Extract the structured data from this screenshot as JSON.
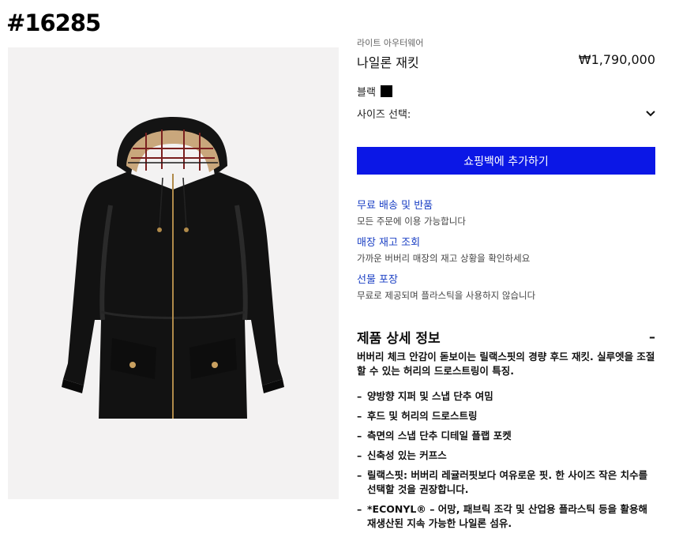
{
  "page_tag": "#16285",
  "product": {
    "category": "라이트 아우터웨어",
    "name": "나일론 재킷",
    "price": "₩1,790,000",
    "image_alt": "black hooded nylon jacket with check lining"
  },
  "options": {
    "color_label": "블랙",
    "color_hex": "#000000",
    "size_label": "사이즈 선택:",
    "size_icon": "chevron-down-icon"
  },
  "cart": {
    "add_label": "쇼핑백에 추가하기",
    "button_color": "#0b17e6"
  },
  "services": [
    {
      "link": "무료 배송 및 반품",
      "desc": "모든 주문에 이용 가능합니다"
    },
    {
      "link": "매장 재고 조회",
      "desc": "가까운 버버리 매장의 재고 상황을 확인하세요"
    },
    {
      "link": "선물 포장",
      "desc": "무료로 제공되며 플라스틱을 사용하지 않습니다"
    }
  ],
  "details": {
    "heading": "제품 상세 정보",
    "toggle": "–",
    "intro": "버버리 체크 안감이 돋보이는 릴랙스핏의 경량 후드 재킷. 실루엣을 조절할 수 있는 허리의 드로스트링이 특징.",
    "bullets": [
      "양방향 지퍼 및 스냅 단추 여밈",
      "후드 및 허리의 드로스트링",
      "측면의 스냅 단추 디테일 플랩 포켓",
      "신축성 있는 커프스",
      "릴랙스핏: 버버리 레귤러핏보다 여유로운 핏. 한 사이즈 작은 치수를 선택할 것을 권장합니다.",
      "*ECONYL® – 어망, 패브릭 조각 및 산업용 플라스틱 등을 활용해 재생산된 지속 가능한 나일론 섬유."
    ]
  }
}
